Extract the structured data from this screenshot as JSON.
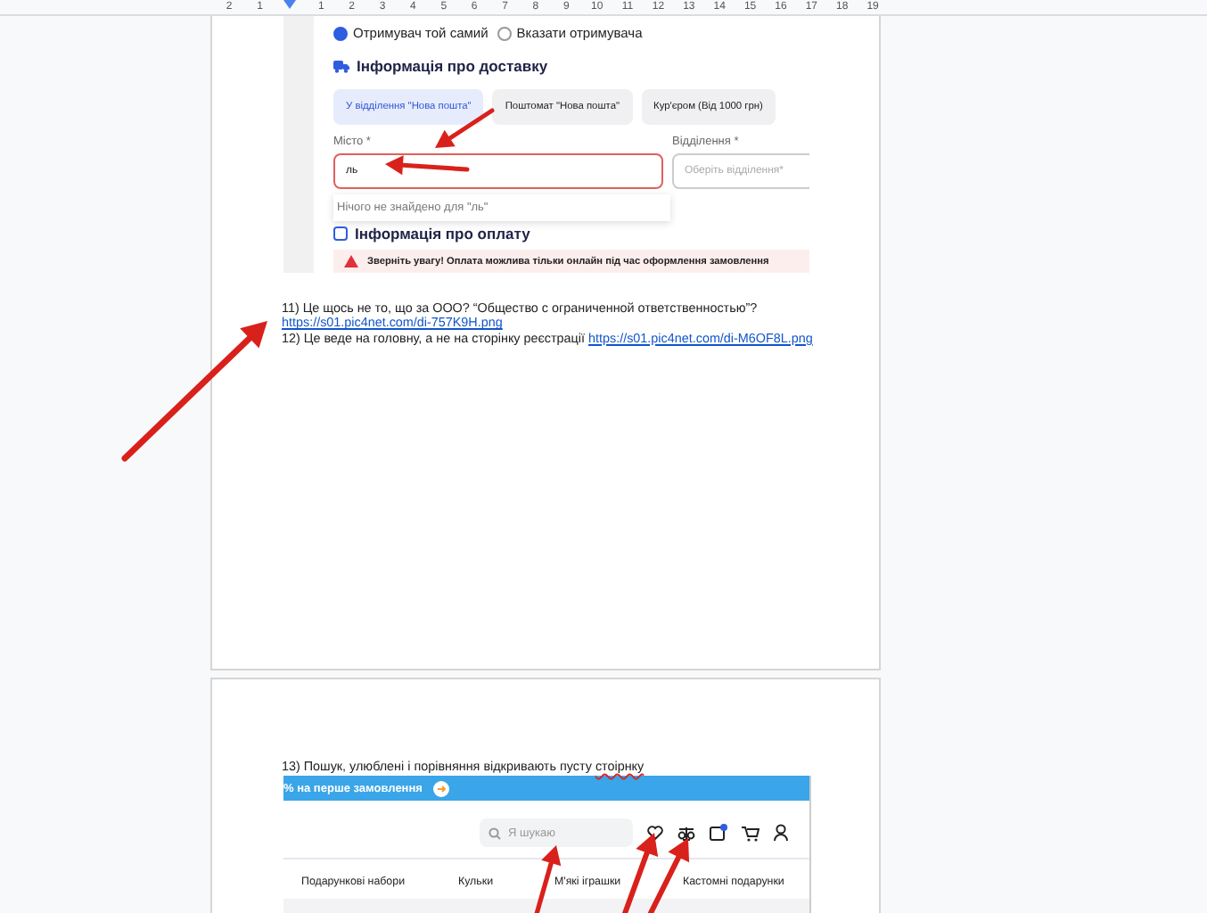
{
  "ruler": {
    "marks": [
      "2",
      "1",
      "1",
      "2",
      "3",
      "4",
      "5",
      "6",
      "7",
      "8",
      "9",
      "10",
      "11",
      "12",
      "13",
      "14",
      "15",
      "16",
      "17",
      "18",
      "19"
    ]
  },
  "page_1": {
    "screenshot": {
      "recipient_options": [
        {
          "label": "Отримувач той самий",
          "selected": true
        },
        {
          "label": "Вказати отримувача",
          "selected": false
        }
      ],
      "delivery_heading": "Інформація про доставку",
      "delivery_tabs": [
        {
          "label": "У відділення \"Нова пошта\"",
          "selected": true
        },
        {
          "label": "Поштомат \"Нова пошта\"",
          "selected": false
        },
        {
          "label": "Кур'єром (Від 1000 грн)",
          "selected": false
        }
      ],
      "city_field": {
        "label": "Місто *",
        "value": "ль",
        "invalid": true
      },
      "branch_field": {
        "label": "Відділення *",
        "placeholder": "Оберіть відділення*"
      },
      "dropdown_message": "Нічого не знайдено для \"ль\"",
      "payment_heading": {
        "label": "Інформація про оплату",
        "checked": false
      },
      "alert": "Зверніть увагу! Оплата можлива тільки онлайн під час оформлення замовлення"
    },
    "notes": [
      {
        "text": "11) Це щось не то, що за ООО? “Общество с ограниченной ответственностью”?",
        "link": "https://s01.pic4net.com/di-757K9H.png"
      },
      {
        "text": "12) Це веде на головну, а не на сторінку реєстрації",
        "link": "https://s01.pic4net.com/di-M6OF8L.png"
      }
    ]
  },
  "page_2": {
    "note": {
      "text": "13) Пошук, улюблені і порівняння відкривають пусту",
      "misspelled": "стоірнку"
    },
    "screenshot": {
      "promo": "% на перше замовлення",
      "search_placeholder": "Я шукаю",
      "nav": [
        "Подарункові набори",
        "Кульки",
        "М'які іграшки",
        "Кастомні подарунки"
      ]
    }
  }
}
